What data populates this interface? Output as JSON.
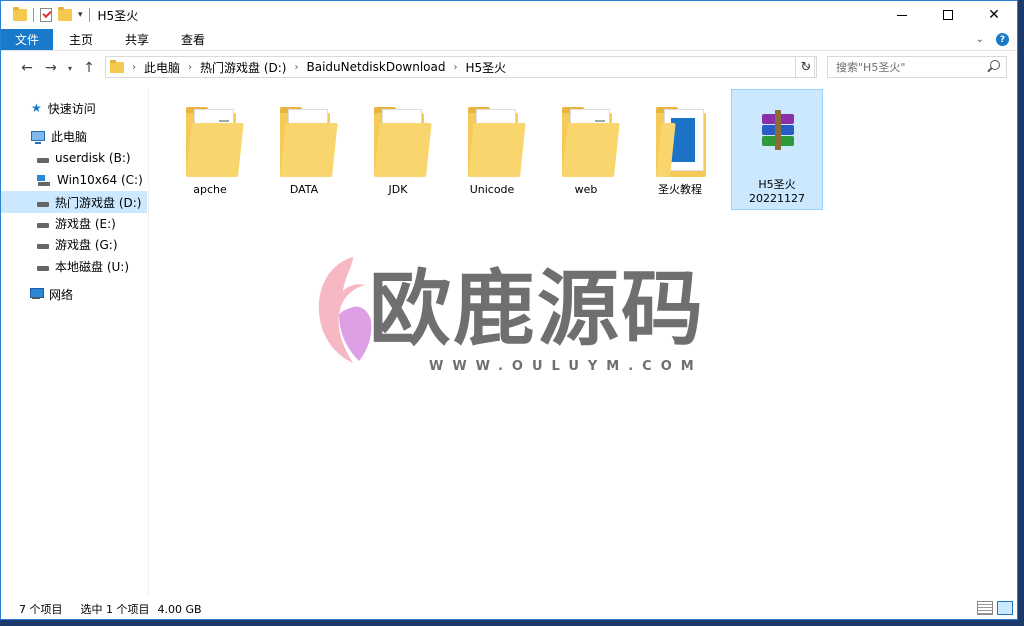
{
  "titlebar": {
    "title": "H5圣火",
    "minimize": "",
    "maximize": "",
    "close": "✕"
  },
  "ribbon": {
    "tabs": [
      "文件",
      "主页",
      "共享",
      "查看"
    ]
  },
  "address": {
    "crumbs": [
      "此电脑",
      "热门游戏盘 (D:)",
      "BaiduNetdiskDownload",
      "H5圣火"
    ],
    "search_placeholder": "搜索\"H5圣火\""
  },
  "sidebar": {
    "items": [
      {
        "label": "快速访问",
        "icon": "star-icon"
      },
      {
        "label": "此电脑",
        "icon": "computer-icon"
      },
      {
        "label": "userdisk (B:)",
        "icon": "drive-icon"
      },
      {
        "label": "Win10x64 (C:)",
        "icon": "windows-drive-icon"
      },
      {
        "label": "热门游戏盘 (D:)",
        "icon": "drive-icon",
        "selected": true
      },
      {
        "label": "游戏盘 (E:)",
        "icon": "drive-icon"
      },
      {
        "label": "游戏盘 (G:)",
        "icon": "drive-icon"
      },
      {
        "label": "本地磁盘 (U:)",
        "icon": "drive-icon"
      },
      {
        "label": "网络",
        "icon": "network-icon"
      }
    ]
  },
  "files": [
    {
      "name": "apche",
      "type": "folder",
      "icon": "folder-icon"
    },
    {
      "name": "DATA",
      "type": "folder",
      "icon": "folder-icon"
    },
    {
      "name": "JDK",
      "type": "folder",
      "icon": "folder-icon"
    },
    {
      "name": "Unicode",
      "type": "folder",
      "icon": "folder-icon"
    },
    {
      "name": "web",
      "type": "folder",
      "icon": "folder-icon"
    },
    {
      "name": "圣火教程",
      "type": "folder",
      "icon": "folder-icon"
    },
    {
      "name": "H5圣火",
      "name_line2": "20221127",
      "type": "archive",
      "icon": "winrar-archive-icon",
      "selected": true
    }
  ],
  "watermark": {
    "text": "欧鹿源码",
    "url": "WWW.OULUYM.COM"
  },
  "status": {
    "count": "7 个项目",
    "selection": "选中 1 个项目",
    "size": "4.00 GB"
  },
  "colors": {
    "accent": "#1979ca",
    "selection": "#cce8ff",
    "folder": "#f6ca58"
  }
}
